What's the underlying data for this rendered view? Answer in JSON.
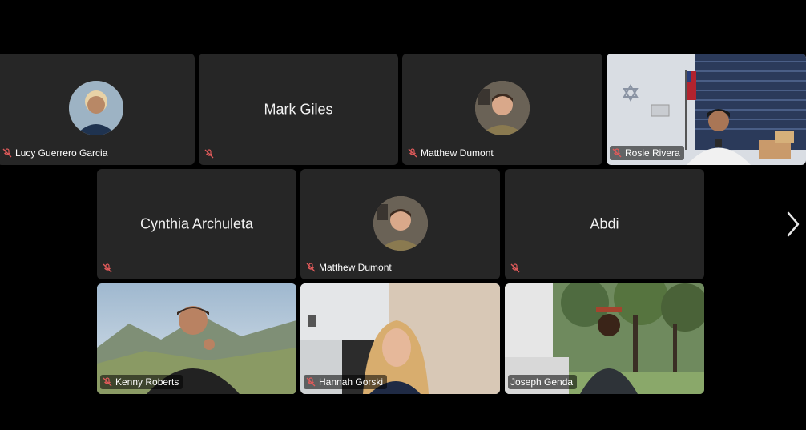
{
  "participants": [
    {
      "name": "Lucy Guerrero Garcia",
      "muted": true,
      "view": "avatar"
    },
    {
      "name": "Mark Giles",
      "muted": true,
      "view": "name"
    },
    {
      "name": "Matthew Dumont",
      "muted": true,
      "view": "avatar"
    },
    {
      "name": "Rosie Rivera",
      "muted": true,
      "view": "video"
    },
    {
      "name": "Cynthia Archuleta",
      "muted": true,
      "view": "name"
    },
    {
      "name": "Matthew Dumont",
      "muted": true,
      "view": "avatar"
    },
    {
      "name": "Abdi",
      "muted": true,
      "view": "name"
    },
    {
      "name": "Kenny Roberts",
      "muted": true,
      "view": "video"
    },
    {
      "name": "Hannah Gorski",
      "muted": true,
      "view": "video"
    },
    {
      "name": "Joseph Genda",
      "muted": true,
      "view": "video"
    }
  ],
  "icons": {
    "mic": "muted-mic-icon",
    "next": "chevron-right-icon"
  },
  "colors": {
    "background": "#000000",
    "tile": "#262626",
    "muted_icon": "#e05a5a"
  }
}
